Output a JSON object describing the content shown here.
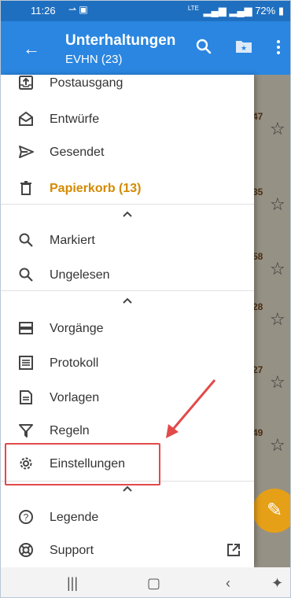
{
  "status": {
    "time": "11:26",
    "network": "LTE",
    "battery": "72%"
  },
  "appbar": {
    "title": "Unterhaltungen",
    "subtitle": "EVHN (23)"
  },
  "drawer": {
    "section1": [
      {
        "icon": "outbox-icon",
        "label": "Postausgang"
      },
      {
        "icon": "drafts-icon",
        "label": "Entwürfe"
      },
      {
        "icon": "send-icon",
        "label": "Gesendet"
      },
      {
        "icon": "trash-icon",
        "label": "Papierkorb (13)"
      }
    ],
    "section2": [
      {
        "icon": "search-icon",
        "label": "Markiert"
      },
      {
        "icon": "search-icon",
        "label": "Ungelesen"
      }
    ],
    "section3": [
      {
        "icon": "operations-icon",
        "label": "Vorgänge"
      },
      {
        "icon": "log-icon",
        "label": "Protokoll"
      },
      {
        "icon": "templates-icon",
        "label": "Vorlagen"
      },
      {
        "icon": "filter-icon",
        "label": "Regeln"
      },
      {
        "icon": "gear-icon",
        "label": "Einstellungen"
      }
    ],
    "section4": [
      {
        "icon": "help-icon",
        "label": "Legende"
      },
      {
        "icon": "support-icon",
        "label": "Support"
      }
    ]
  },
  "background_fragments": [
    "47",
    "35",
    "58",
    "28",
    "27",
    "49"
  ],
  "colors": {
    "statusbar": "#1f6fc0",
    "appbar": "#2a86e0",
    "trash_label": "#d38a00",
    "fab": "#e6a018",
    "highlight": "#e24a4a"
  }
}
